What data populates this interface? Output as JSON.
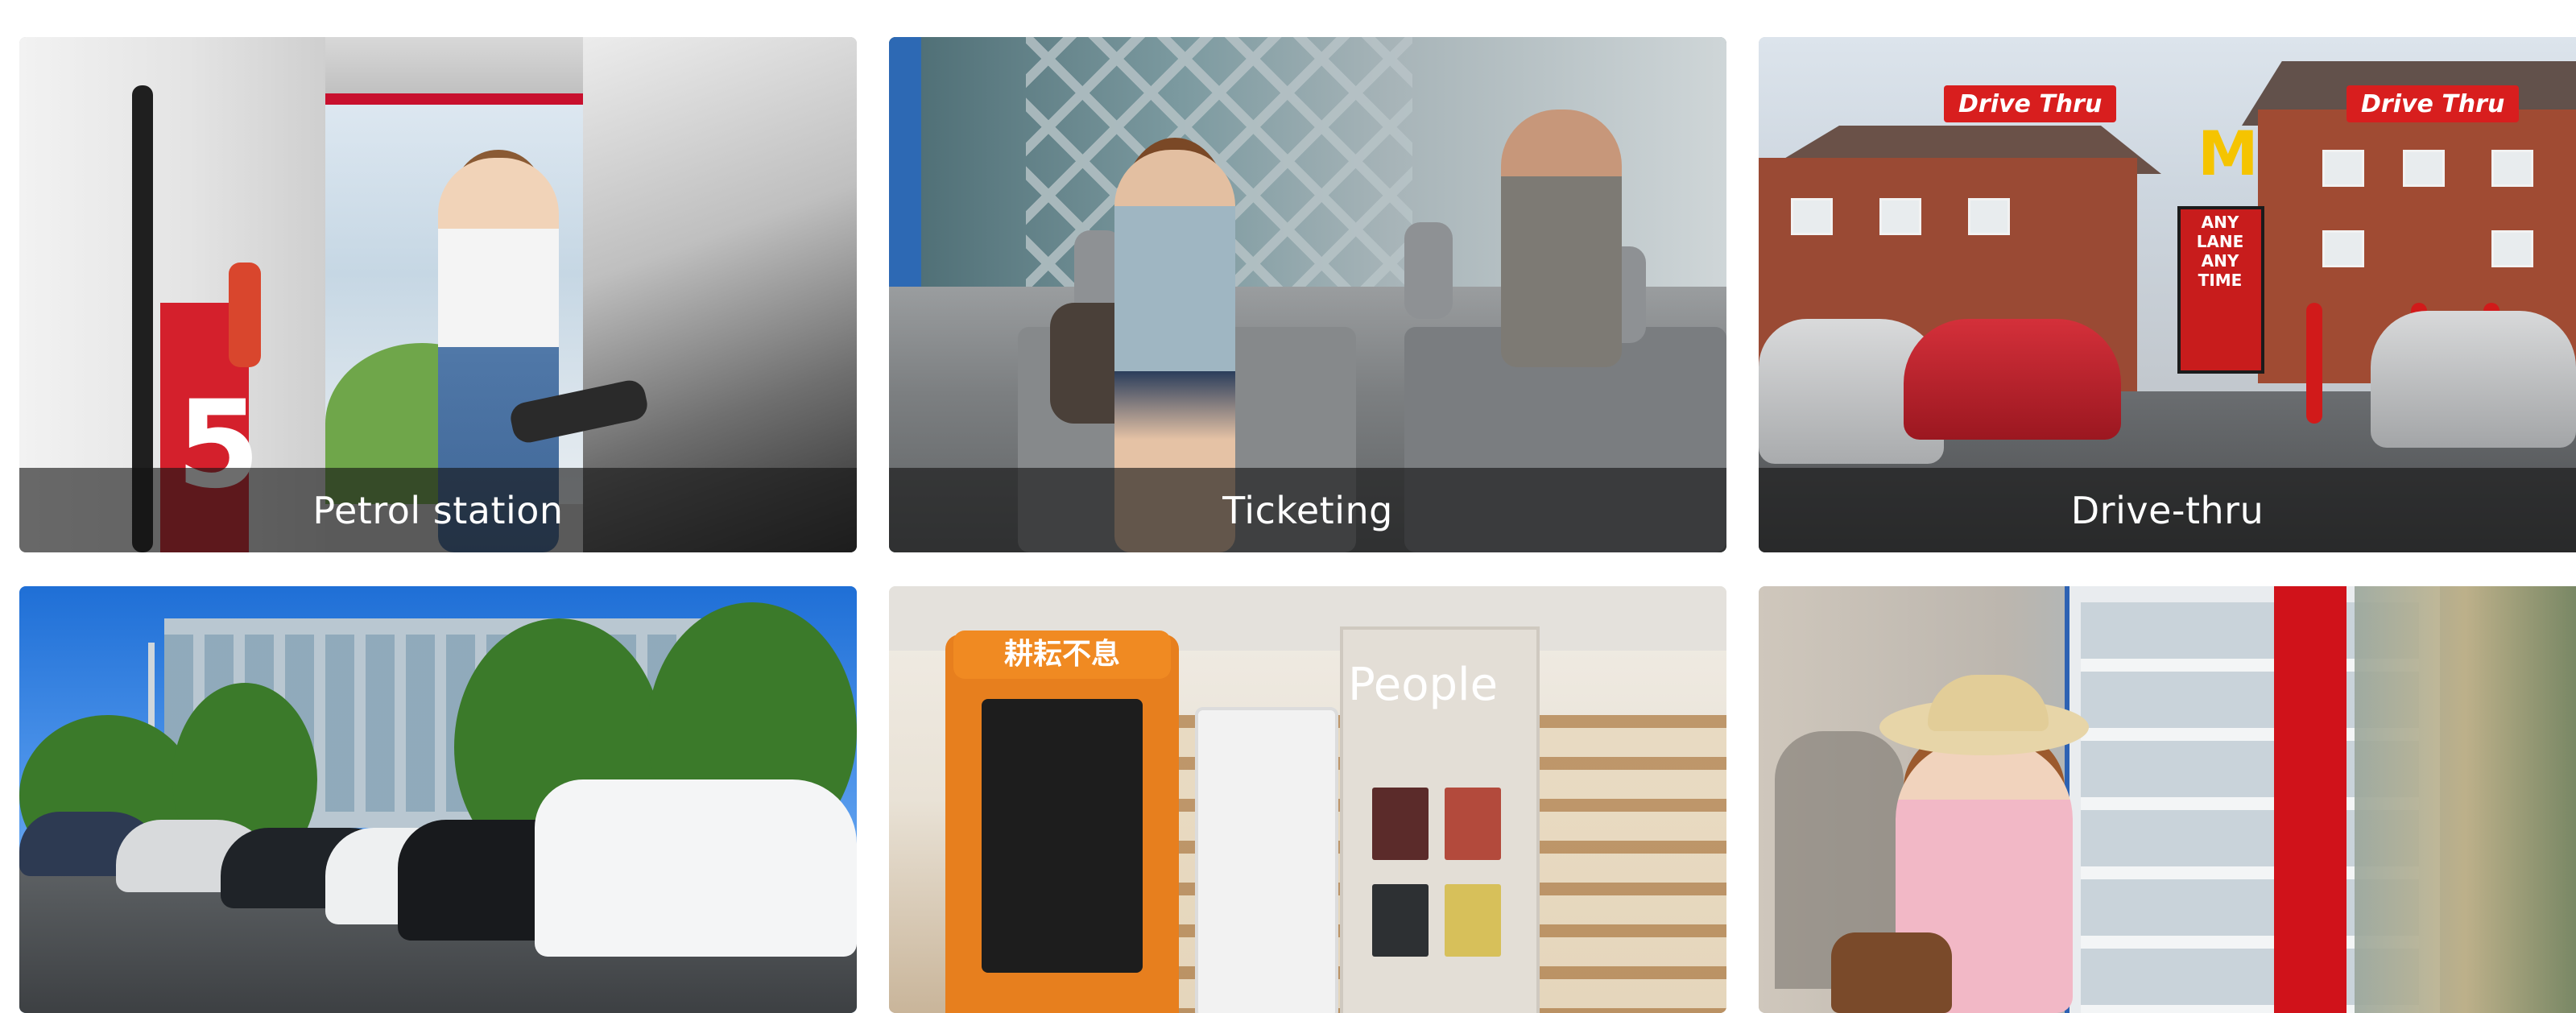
{
  "cards": [
    {
      "caption": "Petrol station",
      "scene": "petrol-station"
    },
    {
      "caption": "Ticketing",
      "scene": "ticketing"
    },
    {
      "caption": "Drive-thru",
      "scene": "drive-thru"
    },
    {
      "caption": "",
      "scene": "ev-parking"
    },
    {
      "caption": "",
      "scene": "library-kiosk"
    },
    {
      "caption": "",
      "scene": "vending-machine"
    }
  ],
  "petrol": {
    "pump_number": "5"
  },
  "drive": {
    "sign1": "Drive Thru",
    "sign2": "Drive Thru",
    "menu_text": "ANY LANE ANY TIME"
  },
  "library": {
    "shelf_label": "People",
    "kiosk_label": "耕耘不息"
  },
  "colors": {
    "caption_overlay": "#141414",
    "caption_text": "#ffffff"
  }
}
